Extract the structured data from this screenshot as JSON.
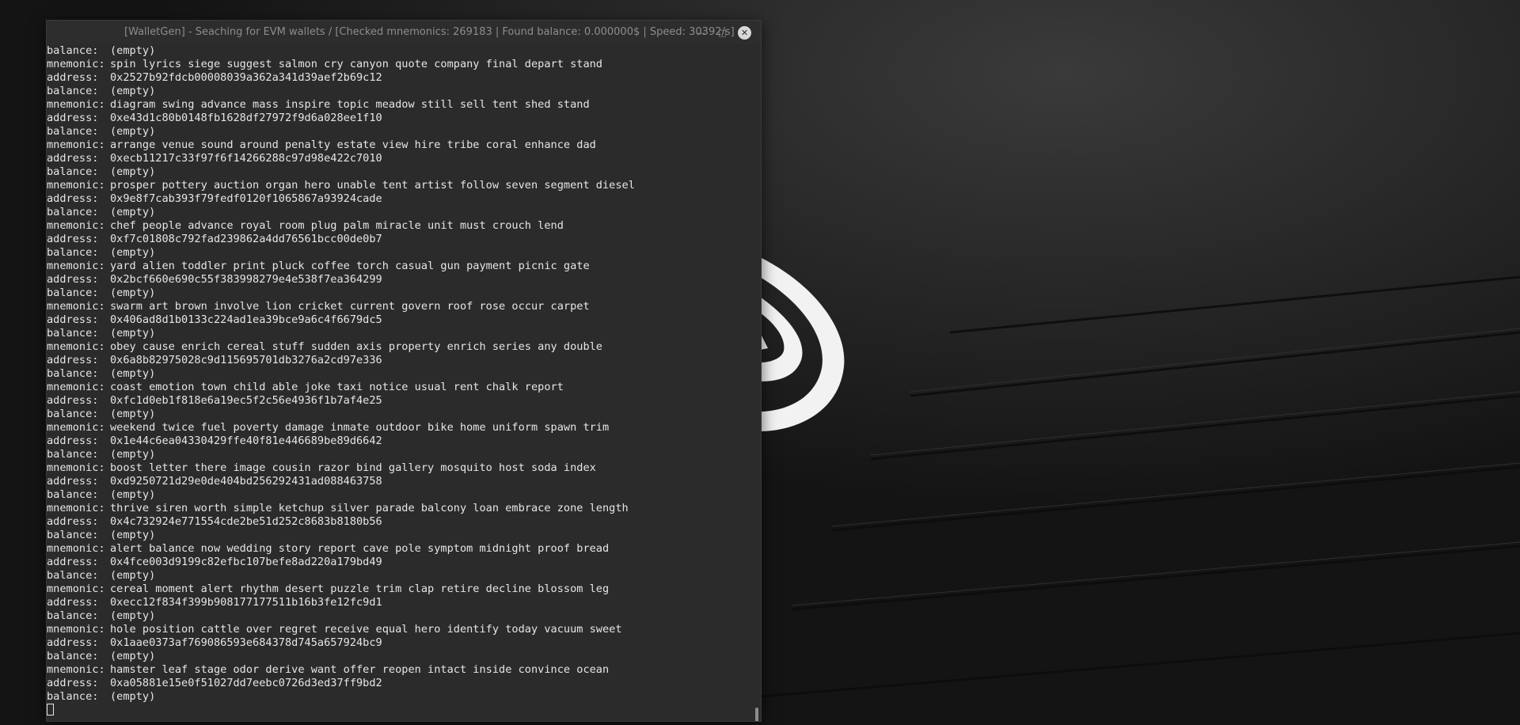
{
  "window": {
    "title": "[WalletGen] - Seaching for EVM wallets / [Checked mnemonics: 269183 | Found balance: 0.000000$ | Speed: 30392/s]",
    "minimize_icon": "minimize-icon",
    "maximize_icon": "maximize-icon",
    "close_icon": "close-icon"
  },
  "labels": {
    "mnemonic": "mnemonic:",
    "address": "address:",
    "balance": "balance:"
  },
  "first_balance": "(empty)",
  "entries": [
    {
      "mnemonic": "spin lyrics siege suggest salmon cry canyon quote company final depart stand",
      "address": "0x2527b92fdcb00008039a362a341d39aef2b69c12",
      "balance": "(empty)"
    },
    {
      "mnemonic": "diagram swing advance mass inspire topic meadow still sell tent shed stand",
      "address": "0xe43d1c80b0148fb1628df27972f9d6a028ee1f10",
      "balance": "(empty)"
    },
    {
      "mnemonic": "arrange venue sound around penalty estate view hire tribe coral enhance dad",
      "address": "0xecb11217c33f97f6f14266288c97d98e422c7010",
      "balance": "(empty)"
    },
    {
      "mnemonic": "prosper pottery auction organ hero unable tent artist follow seven segment diesel",
      "address": "0x9e8f7cab393f79fedf0120f1065867a93924cade",
      "balance": "(empty)"
    },
    {
      "mnemonic": "chef people advance royal room plug palm miracle unit must crouch lend",
      "address": "0xf7c01808c792fad239862a4dd76561bcc00de0b7",
      "balance": "(empty)"
    },
    {
      "mnemonic": "yard alien toddler print pluck coffee torch casual gun payment picnic gate",
      "address": "0x2bcf660e690c55f383998279e4e538f7ea364299",
      "balance": "(empty)"
    },
    {
      "mnemonic": "swarm art brown involve lion cricket current govern roof rose occur carpet",
      "address": "0x406ad8d1b0133c224ad1ea39bce9a6c4f6679dc5",
      "balance": "(empty)"
    },
    {
      "mnemonic": "obey cause enrich cereal stuff sudden axis property enrich series any double",
      "address": "0x6a8b82975028c9d115695701db3276a2cd97e336",
      "balance": "(empty)"
    },
    {
      "mnemonic": "coast emotion town child able joke taxi notice usual rent chalk report",
      "address": "0xfc1d0eb1f818e6a19ec5f2c56e4936f1b7af4e25",
      "balance": "(empty)"
    },
    {
      "mnemonic": "weekend twice fuel poverty damage inmate outdoor bike home uniform spawn trim",
      "address": "0x1e44c6ea04330429ffe40f81e446689be89d6642",
      "balance": "(empty)"
    },
    {
      "mnemonic": "boost letter there image cousin razor bind gallery mosquito host soda index",
      "address": "0xd9250721d29e0de404bd256292431ad088463758",
      "balance": "(empty)"
    },
    {
      "mnemonic": "thrive siren worth simple ketchup silver parade balcony loan embrace zone length",
      "address": "0x4c732924e771554cde2be51d252c8683b8180b56",
      "balance": "(empty)"
    },
    {
      "mnemonic": "alert balance now wedding story report cave pole symptom midnight proof bread",
      "address": "0x4fce003d9199c82efbc107befe8ad220a179bd49",
      "balance": "(empty)"
    },
    {
      "mnemonic": "cereal moment alert rhythm desert puzzle trim clap retire decline blossom leg",
      "address": "0xecc12f834f399b908177177511b16b3fe12fc9d1",
      "balance": "(empty)"
    },
    {
      "mnemonic": "hole position cattle over regret receive equal hero identify today vacuum sweet",
      "address": "0x1aae0373af769086593e684378d745a657924bc9",
      "balance": "(empty)"
    },
    {
      "mnemonic": "hamster leaf stage odor derive want offer reopen intact inside convince ocean",
      "address": "0xa05881e15e0f51027dd7eebc0726d3ed37ff9bd2",
      "balance": "(empty)"
    }
  ],
  "colors": {
    "terminal_bg": "#2b2b2b",
    "terminal_text": "#e6e6e6",
    "desktop_bg": "#1c1c1c"
  }
}
